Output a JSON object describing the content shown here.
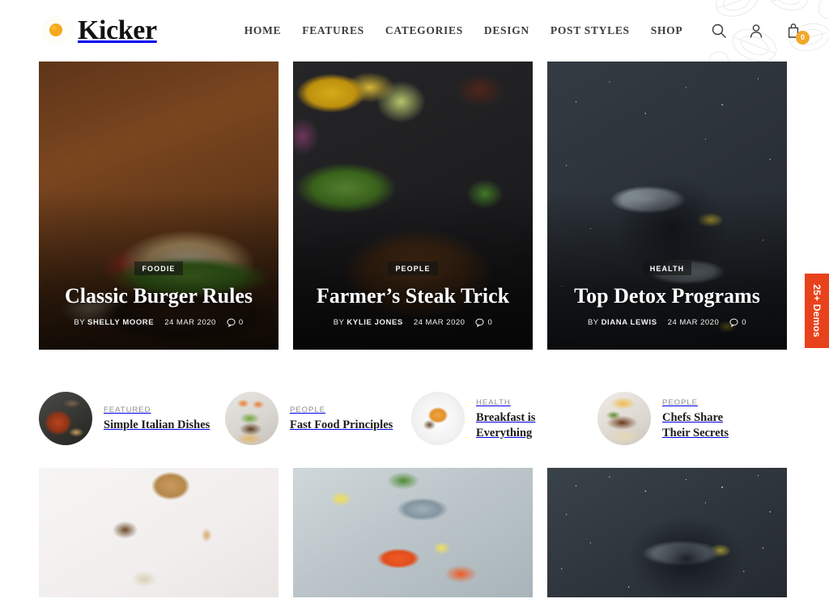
{
  "site": {
    "brand_name": "Kicker",
    "logo_icon": "fried-egg-icon"
  },
  "nav": {
    "items": [
      {
        "label": "HOME"
      },
      {
        "label": "FEATURES"
      },
      {
        "label": "CATEGORIES"
      },
      {
        "label": "DESIGN"
      },
      {
        "label": "POST STYLES"
      },
      {
        "label": "SHOP"
      }
    ]
  },
  "header_icons": {
    "search": {
      "name": "search-icon"
    },
    "account": {
      "name": "user-icon"
    },
    "cart": {
      "name": "shopping-bag-icon",
      "badge_count": "0",
      "badge_color": "#f0a92a"
    }
  },
  "hero_posts": [
    {
      "category": "FOODIE",
      "title": "Classic Burger Rules",
      "author_prefix": "BY",
      "author": "SHELLY MOORE",
      "date": "24 MAR 2020",
      "comments": "0",
      "image_alt": "burger-on-wooden-board"
    },
    {
      "category": "PEOPLE",
      "title": "Farmer’s Steak Trick",
      "author_prefix": "BY",
      "author": "KYLIE JONES",
      "date": "24 MAR 2020",
      "comments": "0",
      "image_alt": "grilled-steak-with-asparagus"
    },
    {
      "category": "HEALTH",
      "title": "Top Detox Programs",
      "author_prefix": "BY",
      "author": "DIANA LEWIS",
      "date": "24 MAR 2020",
      "comments": "0",
      "image_alt": "fish-with-lemon-on-slate"
    }
  ],
  "post_strip": [
    {
      "category": "FEATURED",
      "title": "Simple Italian Dishes",
      "image_alt": "italian-dish-top-view"
    },
    {
      "category": "PEOPLE",
      "title": "Fast Food Principles",
      "image_alt": "fast-food-preparation"
    },
    {
      "category": "HEALTH",
      "title": "Breakfast is Everything",
      "image_alt": "breakfast-bowl-with-fruit"
    },
    {
      "category": "PEOPLE",
      "title": "Chefs Share Their Secrets",
      "image_alt": "plated-chef-dish"
    }
  ],
  "bottom_gallery": [
    {
      "image_alt": "white-flatlay-with-cutting-board-and-egg"
    },
    {
      "image_alt": "fresh-fish-and-salmon-steaks"
    },
    {
      "image_alt": "dark-fish-dish-with-lemon"
    }
  ],
  "demos_tab": {
    "label": "25+ Demos",
    "color": "#e8421c"
  }
}
